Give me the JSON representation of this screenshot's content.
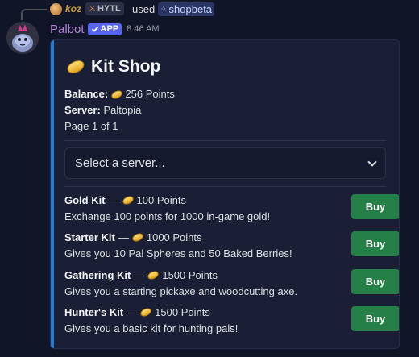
{
  "reply": {
    "username": "koz",
    "tag": "HYTL",
    "used_text": "used",
    "command": "shopbeta"
  },
  "message": {
    "author": "Palbot",
    "app_badge": "APP",
    "time": "8:46 AM"
  },
  "embed": {
    "accent_color": "#1f7dd8",
    "title": "Kit Shop",
    "balance_label": "Balance:",
    "balance_value": "256 Points",
    "server_label": "Server:",
    "server_value": "Paltopia",
    "page_text": "Page 1 of 1",
    "select_placeholder": "Select a server...",
    "kits": [
      {
        "name": "Gold Kit",
        "price": "100 Points",
        "description": "Exchange 100 points for 1000 in-game gold!",
        "button": "Buy"
      },
      {
        "name": "Starter Kit",
        "price": "1000 Points",
        "description": "Gives you 10 Pal Spheres and 50 Baked Berries!",
        "button": "Buy"
      },
      {
        "name": "Gathering Kit",
        "price": "1500 Points",
        "description": "Gives you a starting pickaxe and woodcutting axe.",
        "button": "Buy"
      },
      {
        "name": "Hunter's Kit",
        "price": "1500 Points",
        "description": "Gives you a basic kit for hunting pals!",
        "button": "Buy"
      }
    ]
  },
  "icons": {
    "coin": "coin-icon",
    "chevron": "chevron-down-icon",
    "badge_check": "check-icon",
    "command": "slash-command-icon"
  }
}
